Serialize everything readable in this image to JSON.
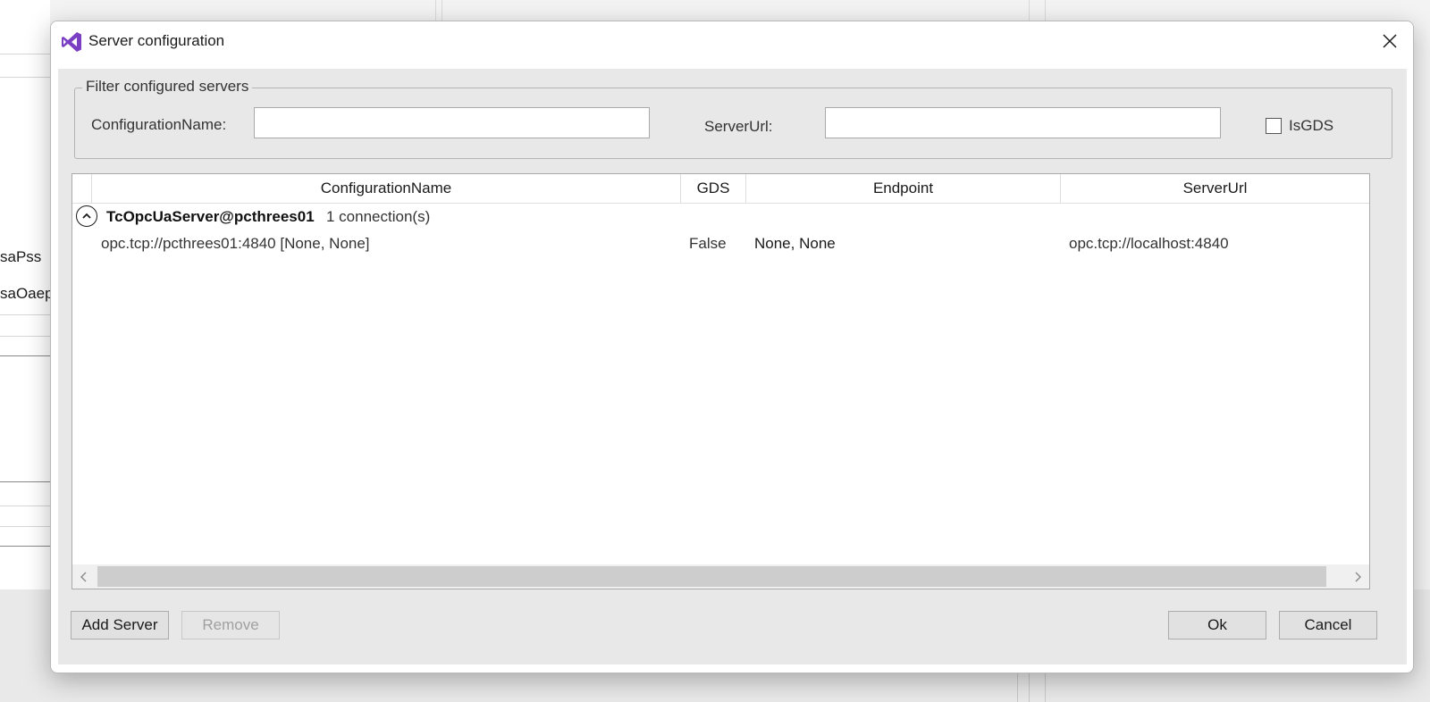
{
  "background": {
    "left_fragments": [
      "saPss",
      "saOaep"
    ]
  },
  "dialog": {
    "title": "Server configuration",
    "filter": {
      "legend": "Filter configured servers",
      "configuration_name_label": "ConfigurationName:",
      "configuration_name_value": "",
      "server_url_label": "ServerUrl:",
      "server_url_value": "",
      "is_gds_label": "IsGDS",
      "is_gds_checked": false
    },
    "grid": {
      "columns": [
        "ConfigurationName",
        "GDS",
        "Endpoint",
        "ServerUrl"
      ],
      "groups": [
        {
          "title": "TcOpcUaServer@pcthrees01",
          "count_text": "1 connection(s)",
          "expanded": true,
          "rows": [
            {
              "configuration_name": "opc.tcp://pcthrees01:4840 [None, None]",
              "gds": "False",
              "endpoint": "None, None",
              "server_url": "opc.tcp://localhost:4840"
            }
          ]
        }
      ]
    },
    "buttons": {
      "add_server": "Add Server",
      "remove": "Remove",
      "ok": "Ok",
      "cancel": "Cancel"
    }
  },
  "icons": {
    "app": "visual-studio-icon",
    "close": "close-icon",
    "expander": "chevron-up-icon",
    "scroll_left": "chevron-left-icon",
    "scroll_right": "chevron-right-icon"
  },
  "colors": {
    "vs_purple": "#7b3fc4",
    "client_bg": "#e8e8e8",
    "disabled_text": "#a0a0a0"
  }
}
